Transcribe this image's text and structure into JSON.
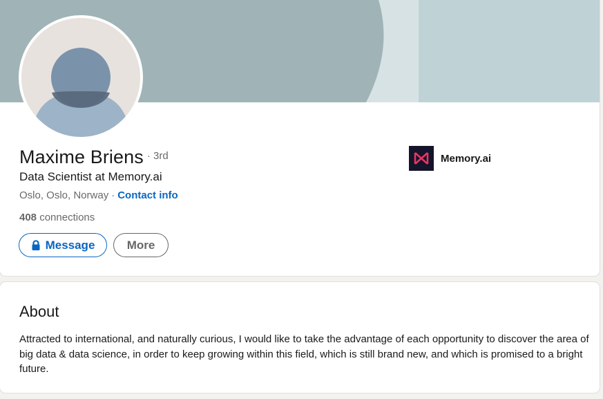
{
  "profile": {
    "name": "Maxime Briens",
    "degree": "· 3rd",
    "headline": "Data Scientist at Memory.ai",
    "location": "Oslo, Oslo, Norway",
    "separator": "·",
    "contact_info_label": "Contact info",
    "connections_count": "408",
    "connections_label": "connections",
    "message_button_label": "Message",
    "more_button_label": "More",
    "avatar_icon": "default-person-avatar"
  },
  "company": {
    "name": "Memory.ai",
    "logo_icon": "memory-ai-logo"
  },
  "about": {
    "title": "About",
    "text": "Attracted to international, and naturally curious, I would like to take the advantage of each opportunity to discover the area of big data & data science, in order to keep growing within this field, which is still brand new, and which is promised to a bright future."
  },
  "colors": {
    "accent": "#0a66c2",
    "banner": "#a0b4b7",
    "company_logo_bg": "#14142b",
    "company_logo_mark": "#e8345f"
  }
}
